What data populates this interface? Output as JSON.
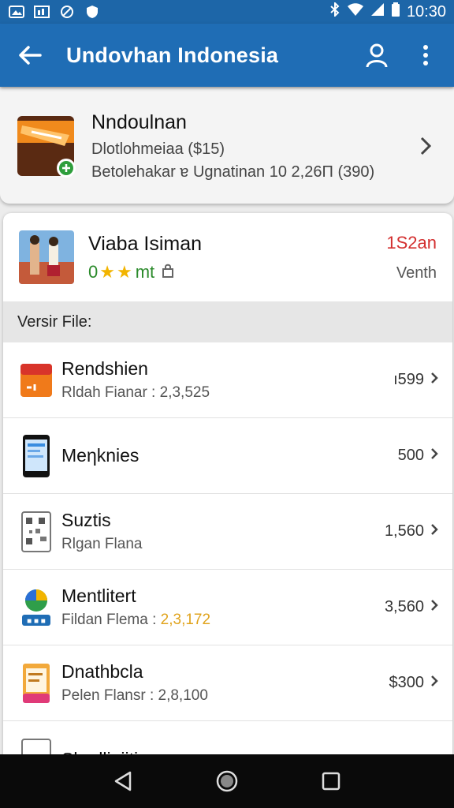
{
  "status_bar": {
    "time": "10:30",
    "icons": [
      "image-icon",
      "gallery-icon",
      "no-disturb-icon",
      "shield-icon",
      "bluetooth-icon",
      "wifi-icon",
      "signal-icon",
      "battery-icon"
    ]
  },
  "app_bar": {
    "title": "Undovhan Indonesia",
    "icons": [
      "back-arrow-icon",
      "profile-icon",
      "more-vert-icon"
    ]
  },
  "top_card": {
    "title": "Nndoulnan",
    "subtitle": "Dlotlohmeiaa ($15)",
    "subtitle2": "Betolehakar ɐ Ugnatinan 10 2,26Π (390)"
  },
  "header_card": {
    "title": "Viaba Isiman",
    "rating_prefix": "0",
    "rating_suffix": "mt",
    "rating_star_count": 2,
    "price": "1S2an",
    "mode": "Venth"
  },
  "section_title": "Versir File:",
  "items": [
    {
      "title": "Rendshien",
      "sub_label": "Rldah Fianar  :",
      "sub_value": "2,3,525",
      "sub_highlight": false,
      "right": "ı599",
      "icon": "orange-book-icon"
    },
    {
      "title": "Meηknies",
      "sub_label": "",
      "sub_value": "",
      "sub_highlight": false,
      "right": "500",
      "icon": "smartphone-icon"
    },
    {
      "title": "Suztis",
      "sub_label": "Rlgan Flana",
      "sub_value": "",
      "sub_highlight": false,
      "right": "1,560",
      "icon": "qr-code-icon"
    },
    {
      "title": "Mentlitert",
      "sub_label": "Fildan Flema :",
      "sub_value": "2,3,172",
      "sub_highlight": true,
      "right": "3,560",
      "icon": "colorful-logo-icon"
    },
    {
      "title": "Dnathbcla",
      "sub_label": "Pelen Flansr  :",
      "sub_value": "2,8,100",
      "sub_highlight": false,
      "right": "$300",
      "icon": "document-app-icon"
    }
  ],
  "partial_item_title": "Skedlieiiti",
  "nav_bar": {
    "icons": [
      "back-triangle-icon",
      "home-circle-icon",
      "recents-square-icon"
    ]
  }
}
